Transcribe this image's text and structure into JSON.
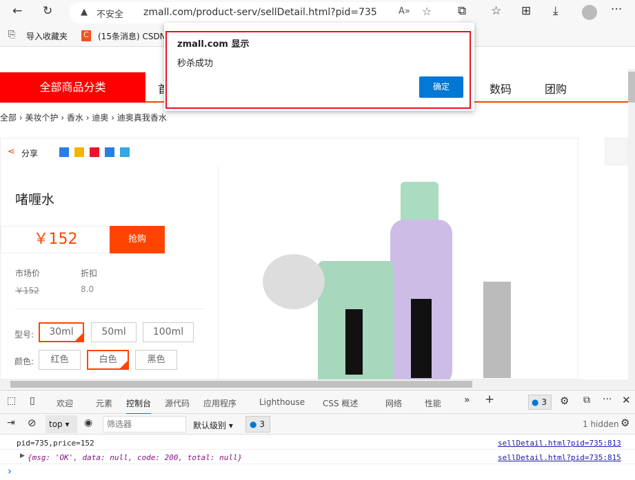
{
  "browser": {
    "security": "不安全",
    "url": "zmall.com/product-serv/sellDetail.html?pid=735",
    "bookmarks": [
      "导入收藏夹",
      "(15条消息) CSDN"
    ]
  },
  "nav": {
    "category": "全部商品分类",
    "items": [
      "首",
      "数码",
      "团购"
    ]
  },
  "breadcrumb": [
    "全部",
    "美妆个护",
    "香水",
    "迪奥",
    "迪奥真我香水"
  ],
  "product": {
    "share": "分享",
    "title": "啫喱水",
    "price": "￥152",
    "buy": "抢购",
    "market_label": "市场价",
    "market_price": "￥152",
    "discount_label": "折扣",
    "discount": "8.0",
    "model_label": "型号:",
    "models": [
      "30ml",
      "50ml",
      "100ml"
    ],
    "color_label": "颜色:",
    "colors": [
      "红色",
      "白色",
      "黑色"
    ],
    "selected_model": "30ml",
    "selected_color": "白色"
  },
  "dialog": {
    "title": "zmall.com 显示",
    "message": "秒杀成功",
    "ok": "确定",
    "accent": "#0078d4"
  },
  "devtools": {
    "tabs": [
      "欢迎",
      "元素",
      "控制台",
      "源代码",
      "应用程序",
      "Lighthouse",
      "CSS 概述",
      "网络",
      "性能"
    ],
    "active_tab": "控制台",
    "issues": "3",
    "context": "top",
    "filter_placeholder": "筛选器",
    "level": "默认级别",
    "hidden": "1 hidden",
    "logs": [
      {
        "text": "pid=735,price=152",
        "src": "sellDetail.html?pid=735:813"
      },
      {
        "text": "{msg: 'OK', data: null, code: 200, total: null}",
        "src": "sellDetail.html?pid=735:815"
      }
    ],
    "prompt": "›"
  }
}
